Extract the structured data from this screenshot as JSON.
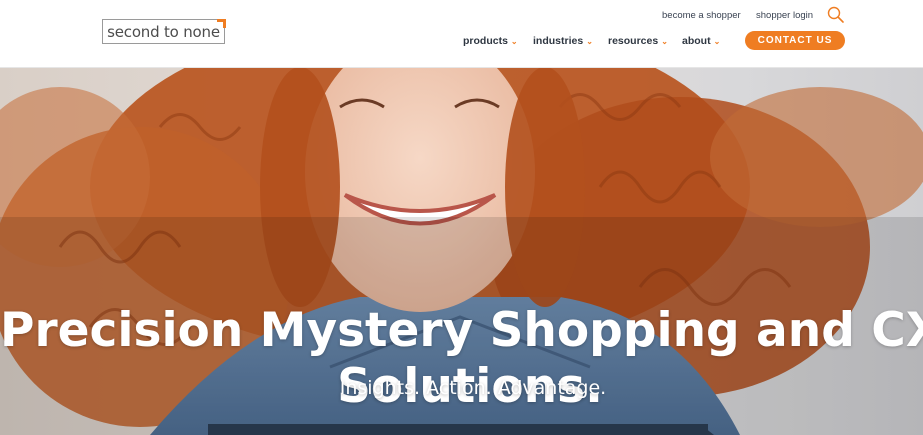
{
  "header": {
    "logo_text": "second to none",
    "utility_links": {
      "become_shopper": "become a shopper",
      "shopper_login": "shopper login"
    },
    "search_icon": "magnifier-icon",
    "nav": {
      "products": "products",
      "industries": "industries",
      "resources": "resources",
      "about": "about",
      "chevron": "⌄"
    },
    "contact_label": "CONTACT US"
  },
  "hero": {
    "title_line1": "Precision Mystery Shopping and CX",
    "title_line2": "Solutions.",
    "subtitle": "Insights. Action. Advantage.",
    "image_subject": "smiling woman with curly red hair in denim jacket"
  },
  "colors": {
    "accent": "#ef7d22",
    "nav_text": "#2f3742",
    "dark_bar": "#26364a"
  }
}
